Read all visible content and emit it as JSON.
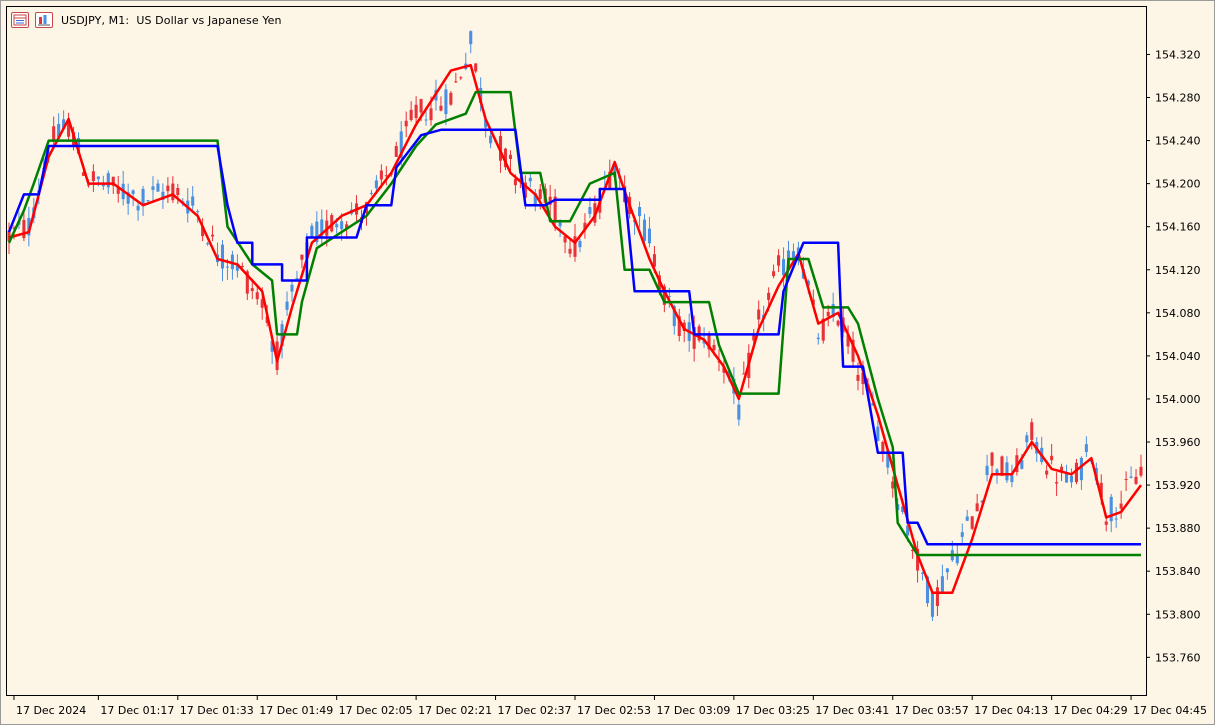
{
  "header": {
    "title": "USDJPY, M1:  US Dollar vs Japanese Yen",
    "icons": [
      "window-list-icon",
      "chart-bars-icon"
    ]
  },
  "colors": {
    "background": "#fdf5e6",
    "bull_candle": "#4a90e2",
    "bear_candle": "#e8323a",
    "red_line": "#ff0000",
    "green_line": "#008000",
    "blue_line": "#0000ff"
  },
  "chart_data": {
    "type": "line",
    "title": "USDJPY, M1:  US Dollar vs Japanese Yen",
    "symbol": "USDJPY",
    "timeframe": "M1",
    "price_axis_position": "right",
    "grid": false,
    "ylim": [
      153.725,
      154.365
    ],
    "y_ticks": [
      "154.320",
      "154.280",
      "154.240",
      "154.200",
      "154.160",
      "154.120",
      "154.080",
      "154.040",
      "154.000",
      "153.960",
      "153.920",
      "153.880",
      "153.840",
      "153.800",
      "153.760"
    ],
    "x_ticks": [
      "17 Dec 2024",
      "17 Dec 01:17",
      "17 Dec 01:33",
      "17 Dec 01:49",
      "17 Dec 02:05",
      "17 Dec 02:21",
      "17 Dec 02:37",
      "17 Dec 02:53",
      "17 Dec 03:09",
      "17 Dec 03:25",
      "17 Dec 03:41",
      "17 Dec 03:57",
      "17 Dec 04:13",
      "17 Dec 04:29",
      "17 Dec 04:45"
    ],
    "x_tick_minutes": [
      60,
      77,
      93,
      109,
      125,
      141,
      157,
      173,
      189,
      205,
      221,
      237,
      253,
      269,
      285
    ],
    "x_range_minutes": [
      59,
      287
    ],
    "candles_close_path": [
      [
        59,
        154.152
      ],
      [
        63,
        154.16
      ],
      [
        67,
        154.235
      ],
      [
        71,
        154.255
      ],
      [
        75,
        154.205
      ],
      [
        80,
        154.195
      ],
      [
        86,
        154.185
      ],
      [
        92,
        154.195
      ],
      [
        97,
        154.175
      ],
      [
        101,
        154.135
      ],
      [
        105,
        154.125
      ],
      [
        110,
        154.09
      ],
      [
        113,
        154.04
      ],
      [
        116,
        154.095
      ],
      [
        120,
        154.15
      ],
      [
        126,
        154.17
      ],
      [
        131,
        154.175
      ],
      [
        136,
        154.215
      ],
      [
        141,
        154.265
      ],
      [
        148,
        154.28
      ],
      [
        152,
        154.33
      ],
      [
        155,
        154.26
      ],
      [
        160,
        154.215
      ],
      [
        165,
        154.19
      ],
      [
        169,
        154.175
      ],
      [
        173,
        154.14
      ],
      [
        177,
        154.175
      ],
      [
        181,
        154.22
      ],
      [
        184,
        154.185
      ],
      [
        188,
        154.15
      ],
      [
        191,
        154.095
      ],
      [
        195,
        154.06
      ],
      [
        199,
        154.06
      ],
      [
        203,
        154.035
      ],
      [
        206,
        153.99
      ],
      [
        210,
        154.07
      ],
      [
        214,
        154.12
      ],
      [
        218,
        154.14
      ],
      [
        222,
        154.06
      ],
      [
        226,
        154.08
      ],
      [
        230,
        154.03
      ],
      [
        234,
        153.975
      ],
      [
        238,
        153.91
      ],
      [
        242,
        153.85
      ],
      [
        245,
        153.81
      ],
      [
        249,
        153.85
      ],
      [
        253,
        153.89
      ],
      [
        257,
        153.945
      ],
      [
        261,
        153.925
      ],
      [
        265,
        153.965
      ],
      [
        269,
        153.935
      ],
      [
        273,
        153.92
      ],
      [
        277,
        153.955
      ],
      [
        280,
        153.895
      ],
      [
        283,
        153.905
      ],
      [
        287,
        153.935
      ]
    ],
    "series": [
      {
        "name": "",
        "color": "#ff0000",
        "points": [
          [
            59,
            154.15
          ],
          [
            63,
            154.155
          ],
          [
            67,
            154.225
          ],
          [
            71,
            154.26
          ],
          [
            75,
            154.2
          ],
          [
            80,
            154.2
          ],
          [
            86,
            154.18
          ],
          [
            92,
            154.19
          ],
          [
            97,
            154.17
          ],
          [
            101,
            154.13
          ],
          [
            105,
            154.125
          ],
          [
            110,
            154.1
          ],
          [
            113,
            154.035
          ],
          [
            116,
            154.085
          ],
          [
            120,
            154.145
          ],
          [
            126,
            154.17
          ],
          [
            131,
            154.18
          ],
          [
            136,
            154.21
          ],
          [
            141,
            154.255
          ],
          [
            148,
            154.305
          ],
          [
            152,
            154.31
          ],
          [
            155,
            154.26
          ],
          [
            160,
            154.21
          ],
          [
            165,
            154.19
          ],
          [
            169,
            154.16
          ],
          [
            173,
            154.145
          ],
          [
            177,
            154.17
          ],
          [
            181,
            154.22
          ],
          [
            184,
            154.18
          ],
          [
            188,
            154.13
          ],
          [
            191,
            154.1
          ],
          [
            195,
            154.065
          ],
          [
            199,
            154.055
          ],
          [
            203,
            154.03
          ],
          [
            206,
            154.0
          ],
          [
            210,
            154.065
          ],
          [
            214,
            154.105
          ],
          [
            218,
            154.135
          ],
          [
            222,
            154.07
          ],
          [
            226,
            154.08
          ],
          [
            230,
            154.04
          ],
          [
            234,
            153.985
          ],
          [
            238,
            153.92
          ],
          [
            242,
            153.855
          ],
          [
            245,
            153.82
          ],
          [
            249,
            153.82
          ],
          [
            253,
            153.87
          ],
          [
            257,
            153.93
          ],
          [
            261,
            153.93
          ],
          [
            265,
            153.96
          ],
          [
            269,
            153.935
          ],
          [
            273,
            153.93
          ],
          [
            277,
            153.945
          ],
          [
            280,
            153.89
          ],
          [
            283,
            153.895
          ],
          [
            287,
            153.92
          ]
        ]
      },
      {
        "name": "",
        "color": "#008000",
        "points": [
          [
            59,
            154.145
          ],
          [
            62,
            154.175
          ],
          [
            64,
            154.2
          ],
          [
            67,
            154.24
          ],
          [
            75,
            154.24
          ],
          [
            84,
            154.24
          ],
          [
            101,
            154.24
          ],
          [
            103,
            154.16
          ],
          [
            108,
            154.125
          ],
          [
            112,
            154.11
          ],
          [
            113,
            154.06
          ],
          [
            117,
            154.06
          ],
          [
            118,
            154.09
          ],
          [
            121,
            154.14
          ],
          [
            126,
            154.155
          ],
          [
            131,
            154.17
          ],
          [
            136,
            154.2
          ],
          [
            141,
            154.235
          ],
          [
            145,
            154.255
          ],
          [
            151,
            154.265
          ],
          [
            153,
            154.285
          ],
          [
            160,
            154.285
          ],
          [
            162,
            154.21
          ],
          [
            166,
            154.21
          ],
          [
            168,
            154.165
          ],
          [
            172,
            154.165
          ],
          [
            176,
            154.2
          ],
          [
            181,
            154.21
          ],
          [
            183,
            154.12
          ],
          [
            188,
            154.12
          ],
          [
            191,
            154.09
          ],
          [
            200,
            154.09
          ],
          [
            202,
            154.05
          ],
          [
            206,
            154.005
          ],
          [
            214,
            154.005
          ],
          [
            216,
            154.13
          ],
          [
            220,
            154.13
          ],
          [
            223,
            154.085
          ],
          [
            228,
            154.085
          ],
          [
            230,
            154.07
          ],
          [
            234,
            154.0
          ],
          [
            237,
            153.955
          ],
          [
            238,
            153.885
          ],
          [
            242,
            153.855
          ],
          [
            287,
            153.855
          ]
        ]
      },
      {
        "name": "",
        "color": "#0000ff",
        "points": [
          [
            59,
            154.155
          ],
          [
            62,
            154.19
          ],
          [
            65,
            154.19
          ],
          [
            67,
            154.235
          ],
          [
            101,
            154.235
          ],
          [
            103,
            154.18
          ],
          [
            105,
            154.145
          ],
          [
            108,
            154.145
          ],
          [
            108,
            154.125
          ],
          [
            114,
            154.125
          ],
          [
            114,
            154.11
          ],
          [
            119,
            154.11
          ],
          [
            119,
            154.15
          ],
          [
            129,
            154.15
          ],
          [
            131,
            154.18
          ],
          [
            136,
            154.18
          ],
          [
            137,
            154.215
          ],
          [
            142,
            154.245
          ],
          [
            146,
            154.25
          ],
          [
            153,
            154.25
          ],
          [
            161,
            154.25
          ],
          [
            163,
            154.18
          ],
          [
            167,
            154.18
          ],
          [
            169,
            154.185
          ],
          [
            178,
            154.185
          ],
          [
            178,
            154.195
          ],
          [
            183,
            154.195
          ],
          [
            185,
            154.1
          ],
          [
            196,
            154.1
          ],
          [
            197,
            154.06
          ],
          [
            214,
            154.06
          ],
          [
            215,
            154.1
          ],
          [
            219,
            154.145
          ],
          [
            226,
            154.145
          ],
          [
            227,
            154.03
          ],
          [
            231,
            154.03
          ],
          [
            234,
            153.95
          ],
          [
            239,
            153.95
          ],
          [
            240,
            153.885
          ],
          [
            242,
            153.885
          ],
          [
            244,
            153.865
          ],
          [
            287,
            153.865
          ]
        ]
      }
    ]
  }
}
